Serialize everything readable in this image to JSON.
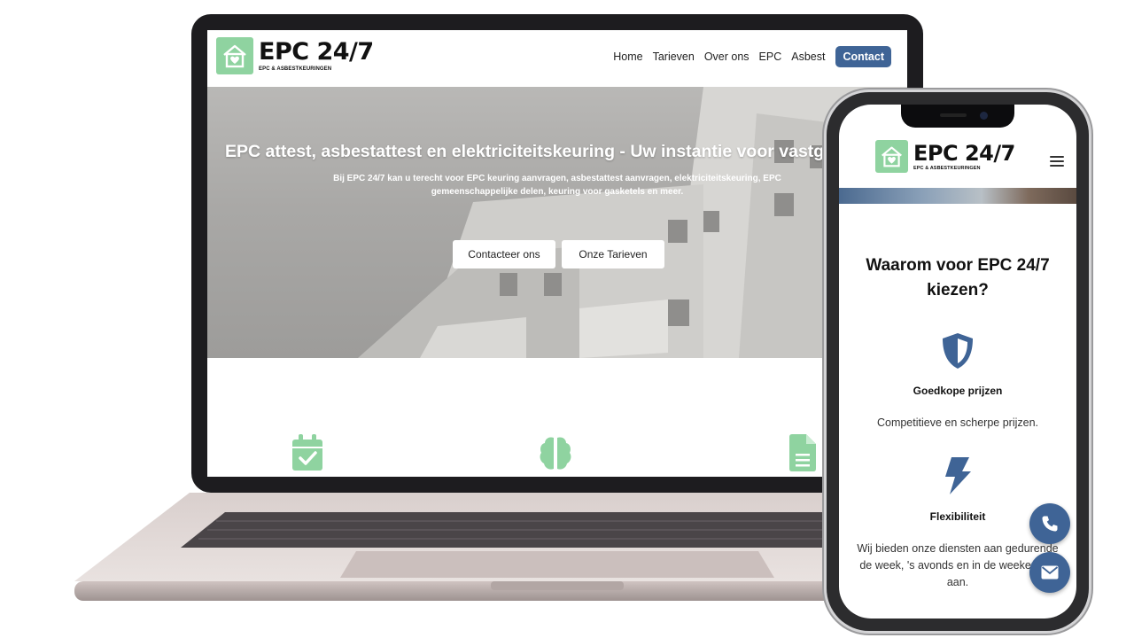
{
  "brand": {
    "name": "EPC 24/7",
    "tagline": "EPC & ASBESTKEURINGEN",
    "accent_green": "#8fd3a0",
    "accent_blue": "#3f6496"
  },
  "desktop": {
    "nav": {
      "items": [
        {
          "label": "Home"
        },
        {
          "label": "Tarieven"
        },
        {
          "label": "Over ons"
        },
        {
          "label": "EPC"
        },
        {
          "label": "Asbest"
        }
      ],
      "cta_label": "Contact"
    },
    "hero": {
      "title": "EPC attest, asbestattest en elektriciteitskeuring - Uw instantie voor vastgoedkeuringen",
      "subtitle": "Bij EPC 24/7 kan u terecht voor EPC keuring aanvragen, asbestattest aanvragen, elektriciteitskeuring, EPC gemeenschappelijke delen, keuring voor gasketels en meer.",
      "buttons": [
        {
          "label": "Contacteer ons"
        },
        {
          "label": "Onze Tarieven"
        }
      ]
    },
    "features": {
      "icons": [
        "calendar-check-icon",
        "brain-icon",
        "document-icon"
      ]
    }
  },
  "mobile": {
    "section_title": "Waarom voor EPC 24/7 kiezen?",
    "features": [
      {
        "icon": "shield-icon",
        "title": "Goedkope prijzen",
        "text": "Competitieve en scherpe prijzen."
      },
      {
        "icon": "bolt-icon",
        "title": "Flexibiliteit",
        "text": "Wij bieden onze diensten aan gedurende de week, 's avonds en in de weekenden aan."
      }
    ],
    "fabs": [
      "phone-icon",
      "mail-icon"
    ]
  }
}
